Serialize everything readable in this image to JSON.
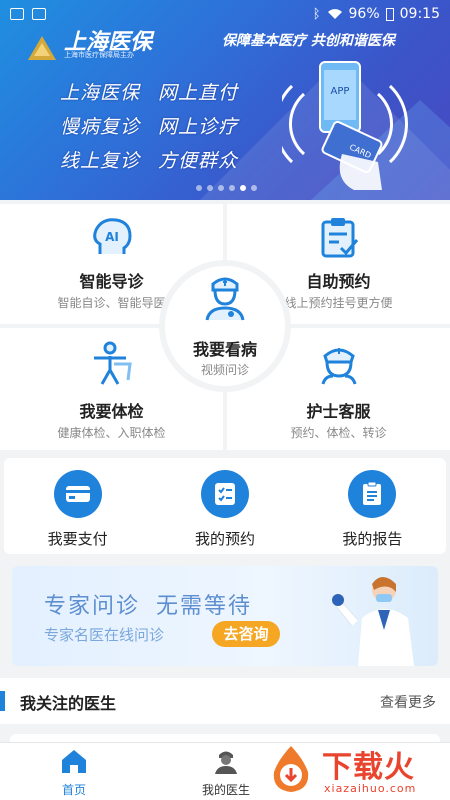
{
  "status_bar": {
    "battery": "96%",
    "time": "09:15"
  },
  "banner": {
    "brand": "上海医保",
    "brand_sub": "上海市医疗保障局主办",
    "slogan": "保障基本医疗  共创和谐医保",
    "lines": [
      [
        "上海医保",
        "网上直付"
      ],
      [
        "慢病复诊",
        "网上诊疗"
      ],
      [
        "线上复诊",
        "方便群众"
      ]
    ],
    "illustration_app": "APP",
    "illustration_card": "CARD",
    "carousel_dots": 6,
    "carousel_active": 4
  },
  "services": {
    "smart_triage": {
      "title": "智能导诊",
      "subtitle": "智能自诊、智能导医",
      "icon": "ai-head-icon"
    },
    "self_booking": {
      "title": "自助预约",
      "subtitle": "线上预约挂号更方便",
      "icon": "clipboard-check-icon"
    },
    "see_doctor": {
      "title": "我要看病",
      "subtitle": "视频问诊",
      "icon": "doctor-icon"
    },
    "checkup": {
      "title": "我要体检",
      "subtitle": "健康体检、入职体检",
      "icon": "body-figure-icon"
    },
    "nurse_service": {
      "title": "护士客服",
      "subtitle": "预约、体检、转诊",
      "icon": "nurse-icon"
    }
  },
  "quick_actions": [
    {
      "label": "我要支付",
      "icon": "pay-card-icon"
    },
    {
      "label": "我的预约",
      "icon": "appointment-list-icon"
    },
    {
      "label": "我的报告",
      "icon": "report-icon"
    }
  ],
  "expert_banner": {
    "heading": [
      "专家问诊",
      "无需等待"
    ],
    "subheading": "专家名医在线问诊",
    "button": "去咨询"
  },
  "followed_doctors": {
    "title": "我关注的医生",
    "more": "查看更多"
  },
  "bottom_nav": [
    {
      "label": "首页",
      "icon": "home-icon",
      "active": true
    },
    {
      "label": "我的医生",
      "icon": "doctor-avatar-icon",
      "active": false
    }
  ],
  "watermark": {
    "text": "下载火",
    "url": "xiazaihuo.com"
  },
  "colors": {
    "primary": "#1f82db",
    "accent_orange": "#f5a623",
    "watermark_red": "#e8442e"
  }
}
